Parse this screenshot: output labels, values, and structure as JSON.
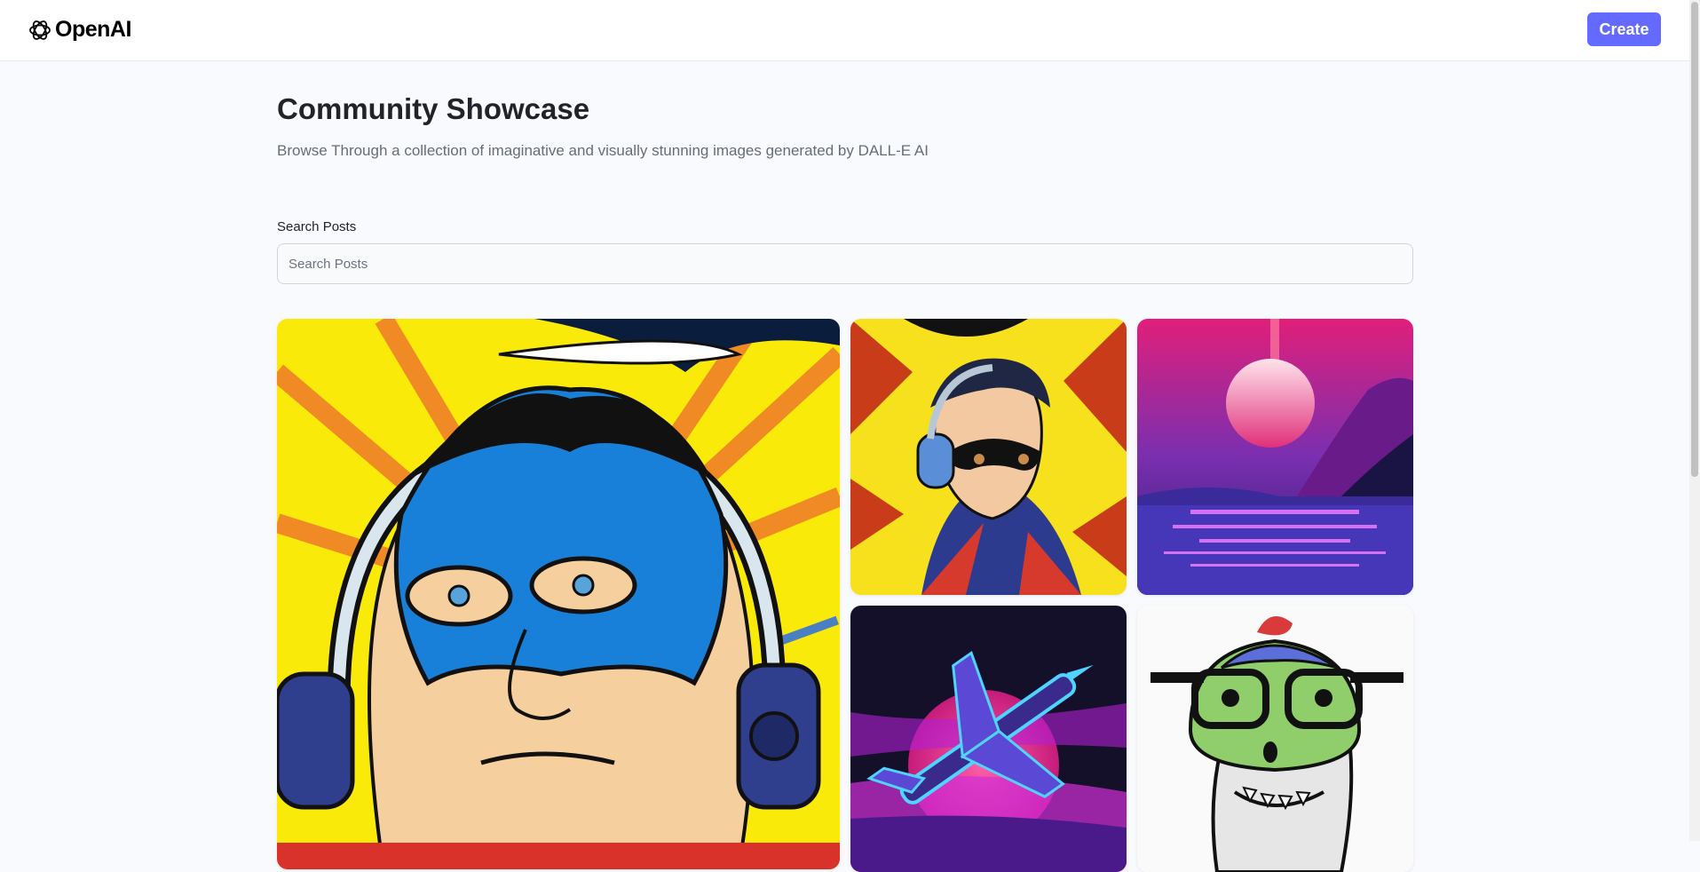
{
  "header": {
    "logo_text": "OpenAI",
    "create_label": "Create"
  },
  "main": {
    "title": "Community Showcase",
    "subtitle": "Browse Through a collection of imaginative and visually stunning images generated by DALL-E AI"
  },
  "search": {
    "label": "Search Posts",
    "placeholder": "Search Posts",
    "value": ""
  },
  "gallery": {
    "items": [
      {
        "subject": "masked hero with headphones, comic style, blue mask"
      },
      {
        "subject": "masked hero with headphones, comic style, yellow burst"
      },
      {
        "subject": "synthwave sunset over water"
      },
      {
        "subject": "neon jet flying past sunset"
      },
      {
        "subject": "cartoon dinosaur with glasses and cap"
      }
    ]
  },
  "colors": {
    "accent": "#6469ff",
    "background": "#f9fafe",
    "title": "#222328",
    "subtitle": "#666e75"
  }
}
